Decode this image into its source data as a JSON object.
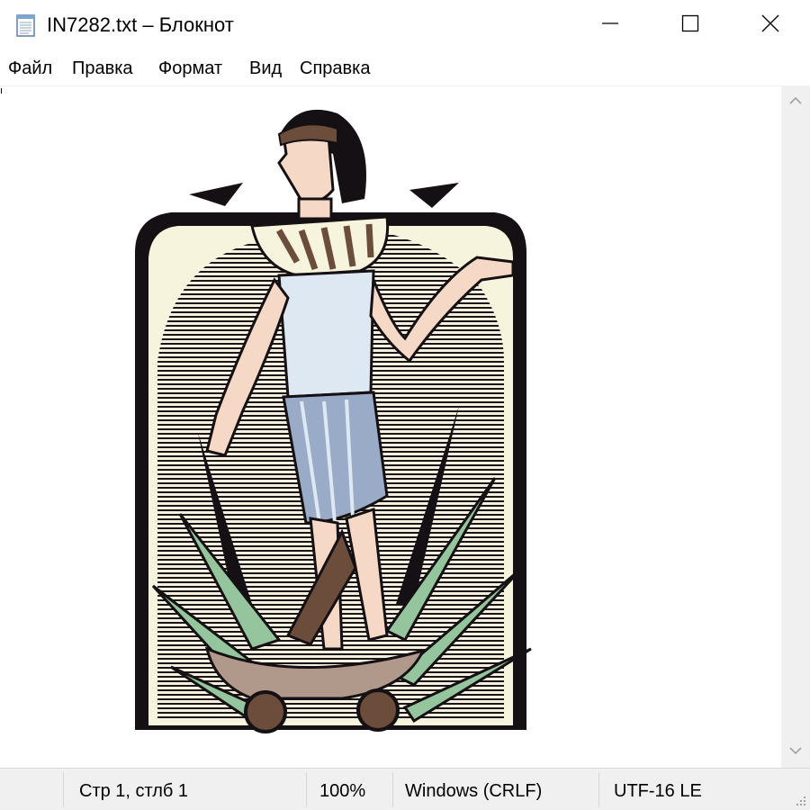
{
  "window": {
    "title": "IN7282.txt – Блокнот",
    "icon": "notepad-icon",
    "controls": [
      "minimize-icon",
      "maximize-icon",
      "close-icon"
    ]
  },
  "menu": {
    "items": [
      {
        "label": "Файл"
      },
      {
        "label": "Правка"
      },
      {
        "label": "Формат"
      },
      {
        "label": "Вид"
      },
      {
        "label": "Справка"
      }
    ]
  },
  "editor": {
    "content_image": "egyptian-woman-clipart",
    "colors": {
      "outline": "#1a1014",
      "skin": "#f5d9c6",
      "dress": "#dde8f2",
      "sash": "#9aabc8",
      "leaves": "#95c59c",
      "frame_fill": "#f7f4de",
      "brown": "#6c4d3b"
    }
  },
  "statusbar": {
    "position": "Стр 1, стлб 1",
    "zoom": "100%",
    "line_endings": "Windows (CRLF)",
    "encoding": "UTF-16 LE"
  },
  "scrollbar": {
    "up_icon": "chevron-up-icon",
    "down_icon": "chevron-down-icon"
  }
}
